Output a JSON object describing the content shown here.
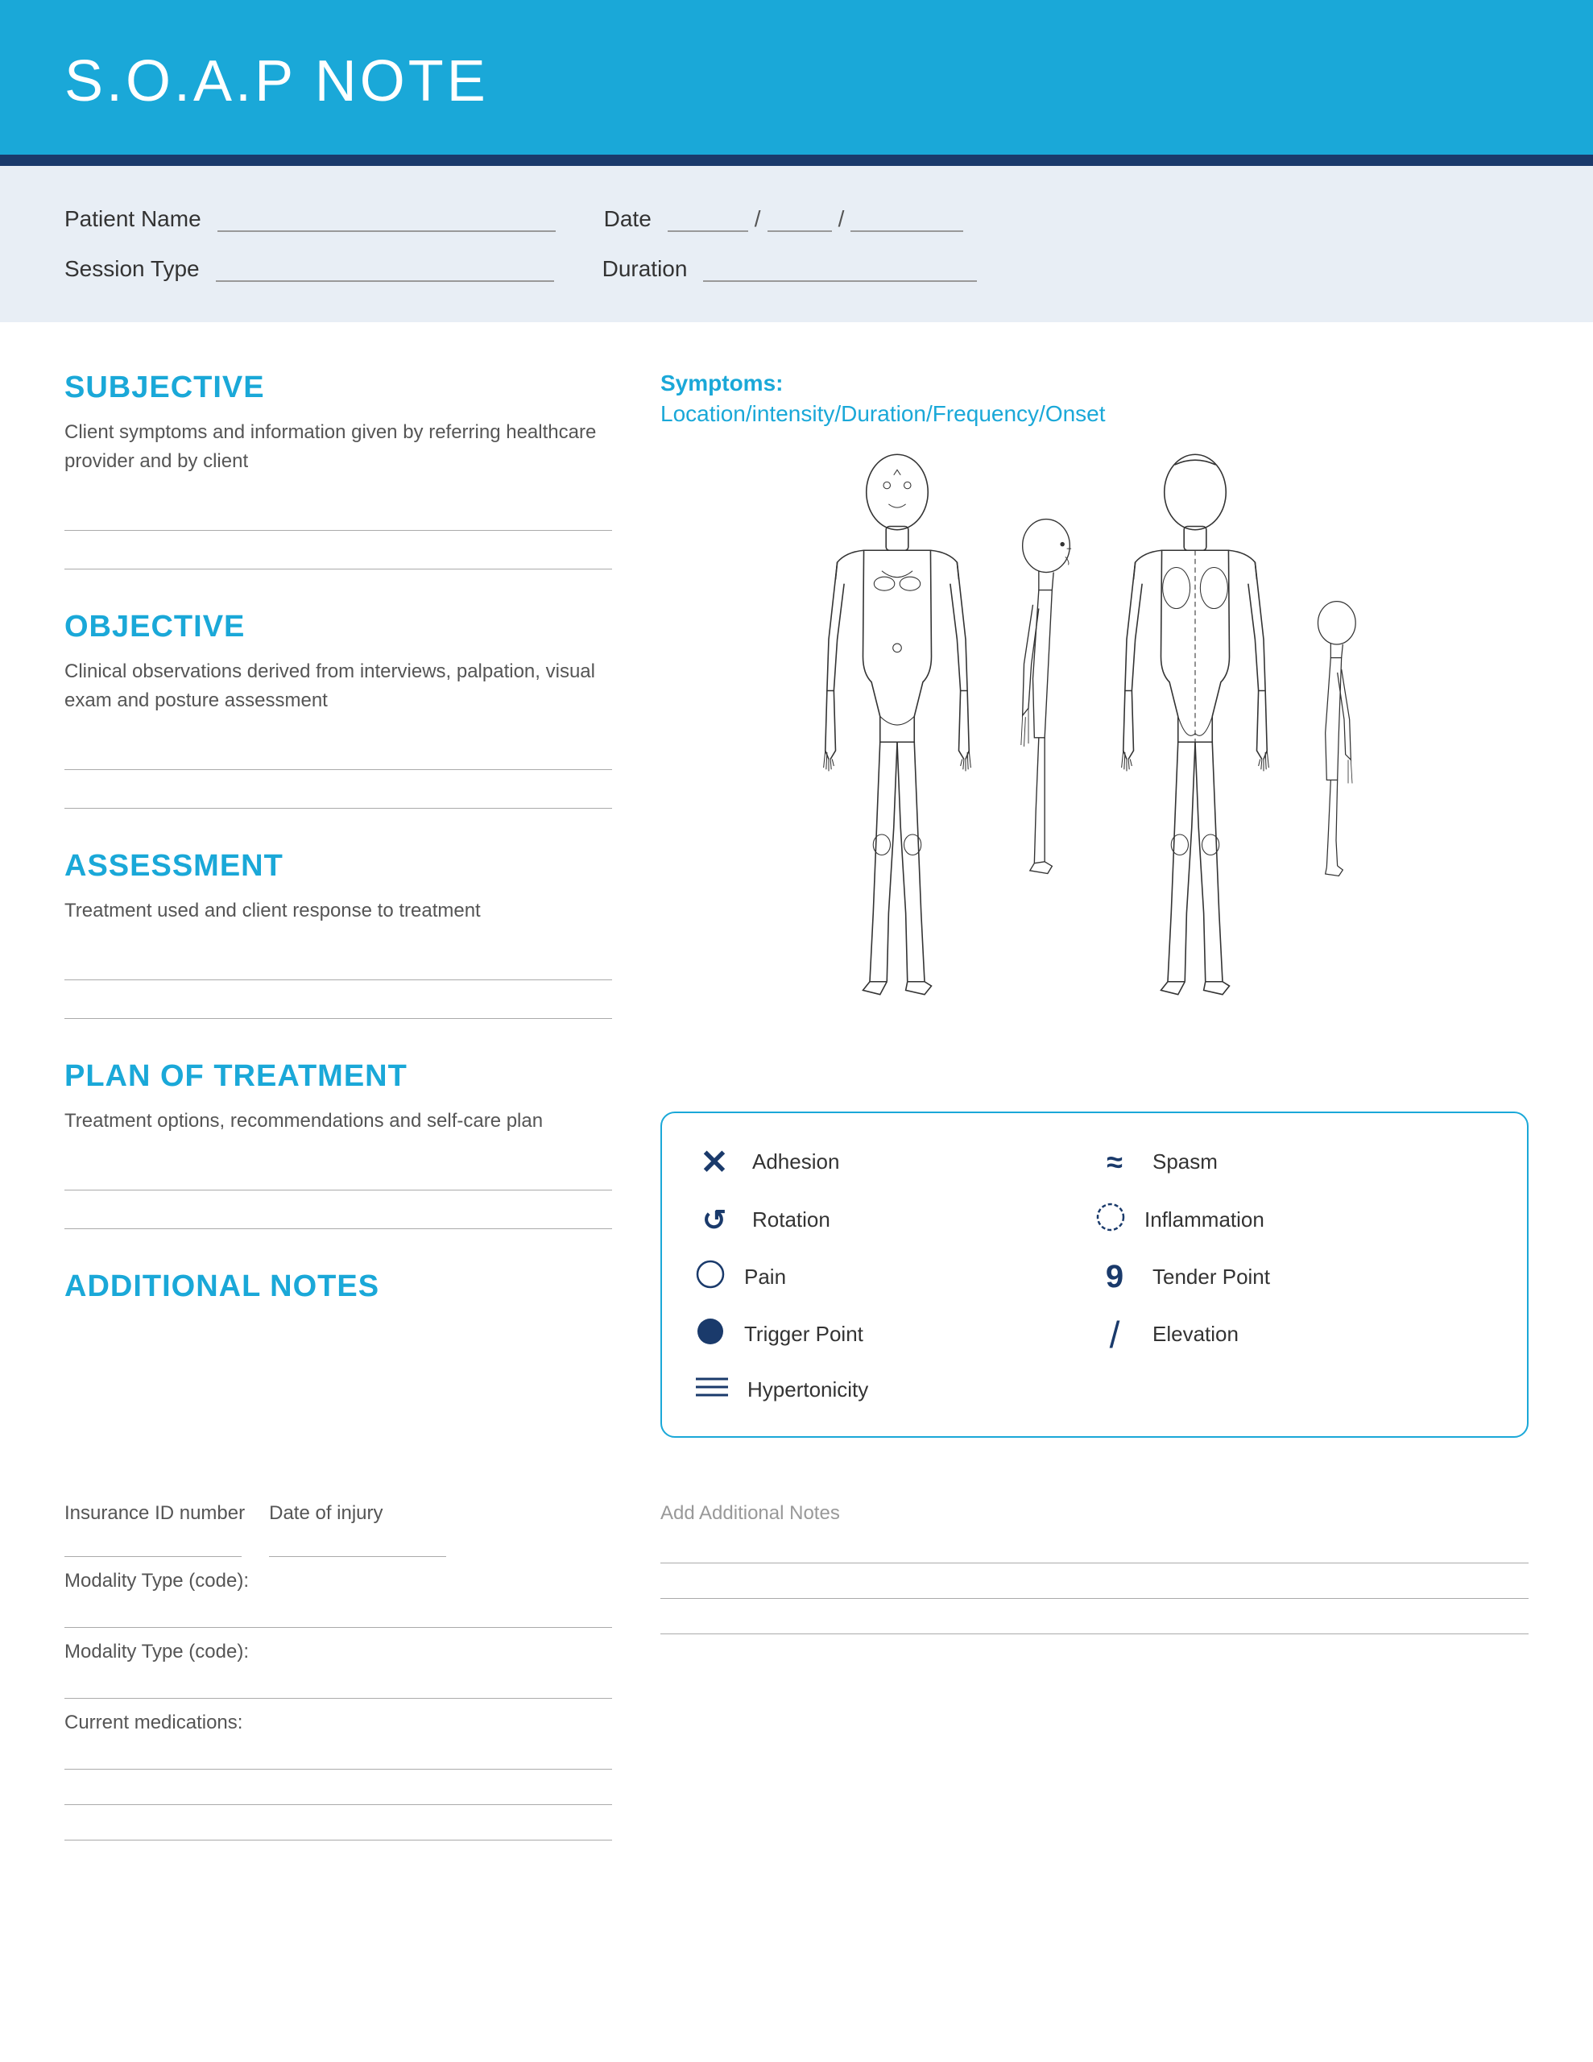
{
  "header": {
    "title": "S.O.A.P NOTE"
  },
  "patient_info": {
    "patient_name_label": "Patient Name",
    "date_label": "Date",
    "session_type_label": "Session Type",
    "duration_label": "Duration"
  },
  "subjective": {
    "heading": "SUBJECTIVE",
    "description": "Client symptoms and information given by referring healthcare provider and by client"
  },
  "objective": {
    "heading": "OBJECTIVE",
    "description": "Clinical observations derived from interviews, palpation, visual exam and posture assessment"
  },
  "assessment": {
    "heading": "ASSESSMENT",
    "description": "Treatment used and client response to treatment"
  },
  "plan": {
    "heading": "PLAN OF TREATMENT",
    "description": "Treatment options, recommendations and self-care plan"
  },
  "additional_notes": {
    "heading": "ADDITIONAL NOTES",
    "insurance_label": "Insurance ID number",
    "date_of_injury_label": "Date of injury",
    "modality1_label": "Modality Type (code):",
    "modality2_label": "Modality Type (code):",
    "medications_label": "Current medications:",
    "add_notes_label": "Add Additional Notes"
  },
  "symptoms": {
    "heading": "Symptoms:",
    "subheading": "Location/intensity/Duration/Frequency/Onset"
  },
  "legend": {
    "items": [
      {
        "symbol": "✕",
        "label": "Adhesion",
        "type": "cross"
      },
      {
        "symbol": "≈",
        "label": "Spasm",
        "type": "wave"
      },
      {
        "symbol": "↺",
        "label": "Rotation",
        "type": "rotation"
      },
      {
        "symbol": "○",
        "label": "Inflammation",
        "type": "circle-outline-blue"
      },
      {
        "symbol": "○",
        "label": "Pain",
        "type": "circle-outline"
      },
      {
        "symbol": "9",
        "label": "Trigger Point",
        "type": "nine"
      },
      {
        "symbol": "●",
        "label": "Tender Point",
        "type": "circle-filled"
      },
      {
        "symbol": "/",
        "label": "Elevation",
        "type": "slash"
      },
      {
        "symbol": "≡",
        "label": "Hypertonicity",
        "type": "lines"
      }
    ]
  }
}
